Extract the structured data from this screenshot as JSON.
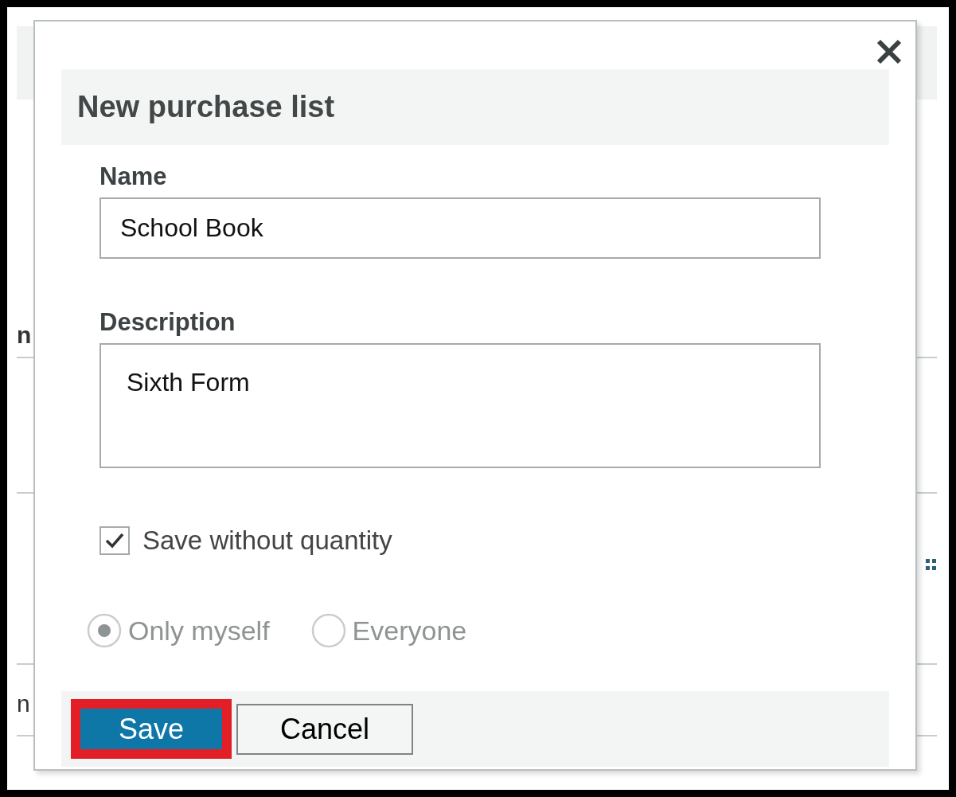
{
  "background": {
    "texts": [
      "n",
      "n"
    ]
  },
  "dialog": {
    "title": "New purchase list",
    "fields": [
      {
        "kind": "input",
        "label": "Name",
        "value": "School Book"
      },
      {
        "kind": "textarea",
        "label": "Description",
        "value": "Sixth Form"
      }
    ],
    "checkbox": {
      "label": "Save without quantity",
      "checked": true
    },
    "visibility": [
      {
        "label": "Only myself",
        "selected": true,
        "disabled": true
      },
      {
        "label": "Everyone",
        "selected": false,
        "disabled": true
      }
    ],
    "buttons": [
      {
        "kind": "primary",
        "label": "Save",
        "highlighted": true
      },
      {
        "kind": "secondary",
        "label": "Cancel",
        "highlighted": false
      }
    ]
  }
}
